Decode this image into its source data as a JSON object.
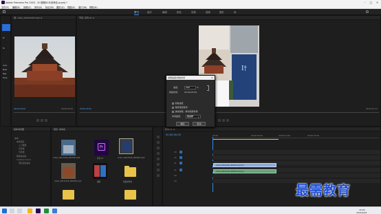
{
  "window": {
    "title": "Adobe Premiere Pro 2020 - D:\\视频\\6.8\\未命名.prproj *"
  },
  "menu": [
    "文件(F)",
    "编辑(E)",
    "剪辑(C)",
    "序列(S)",
    "标记(M)",
    "图形(G)",
    "视图(V)",
    "窗口(W)",
    "帮助(H)"
  ],
  "workspaces": [
    "学习",
    "组件",
    "编辑",
    "颜色",
    "效果",
    "音频",
    "图形",
    "库"
  ],
  "source": {
    "timecode_left": "00;00;00;00",
    "timecode_right": "00;00;05;00",
    "left_labels": [
      "Pr",
      "Tu",
      "Com",
      "New",
      "Rea",
      "Here"
    ]
  },
  "program": {
    "timecode_left": "00;00;00;00",
    "fit": "适合",
    "timecode_right": "00;00;07;11"
  },
  "dialog": {
    "title": "剪辑速度/持续时间",
    "speed_label": "速度：",
    "speed_value": "100",
    "speed_unit": "%",
    "duration_label": "持续时间：",
    "duration_value": "00;00;05;00",
    "options": [
      "倒放速度",
      "保持音频音调",
      "波纹编辑，移动尾部剪辑"
    ],
    "interp_label": "时间插值：",
    "interp_value": "帧采样",
    "ok": "确定",
    "cancel": "取消"
  },
  "project": {
    "tab": "项目: 未命名",
    "items": [
      {
        "label": "序列 01"
      },
      {
        "label": "video_20210126_000436.mp4"
      },
      {
        "label": "video_20210126_000000.mp4"
      },
      {
        "label": "模版"
      },
      {
        "label": "新建文件夹"
      }
    ]
  },
  "left_tree": {
    "items": [
      "本地",
      "本地项目",
      "入门教程",
      "已存储",
      "已存储",
      "网络驱动器",
      "Creative Cloud",
      "团队项目版本"
    ]
  },
  "timeline": {
    "timecode": "00;00;00;00",
    "ruler": [
      "00;00",
      "00;00;05;00",
      "00;00;10;00",
      "00;00;15;00"
    ],
    "tracks_v": [
      "V3",
      "V2",
      "V1"
    ],
    "tracks_a": [
      "A1",
      "A2",
      "A3"
    ],
    "clips": [
      {
        "label": "video_20210126_000436.mp4 [V]"
      },
      {
        "label": "video_20210126_000436.mp4 [A]"
      }
    ]
  },
  "taskbar": {
    "time": "16:02",
    "date": "2021/6/24"
  },
  "watermark": "最需教育",
  "colors": {
    "accent": "#2b8cf0",
    "timecode": "#4fa3ff",
    "watermark": "#1f4fd8"
  }
}
